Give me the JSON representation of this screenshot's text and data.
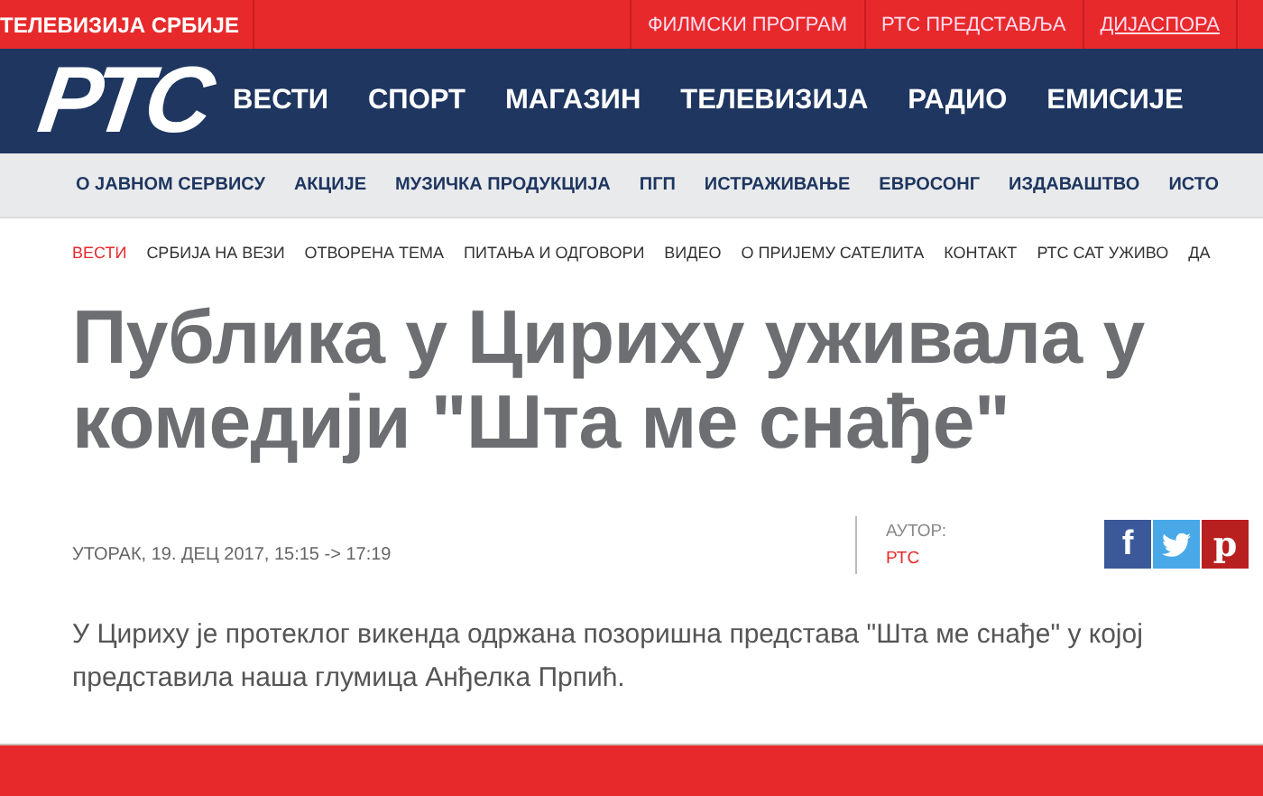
{
  "top_bar": {
    "site_name": "ТЕЛЕВИЗИЈА СРБИЈЕ",
    "links": [
      {
        "label": "ФИЛМСКИ ПРОГРАМ",
        "selected": false
      },
      {
        "label": "РТС ПРЕДСТАВЉА",
        "selected": false
      },
      {
        "label": "ДИЈАСПОРА",
        "selected": true
      }
    ]
  },
  "header": {
    "logo": "РТС",
    "nav": [
      "ВЕСТИ",
      "СПОРТ",
      "МАГАЗИН",
      "ТЕЛЕВИЗИЈА",
      "РАДИО",
      "ЕМИСИЈЕ"
    ]
  },
  "secondary_nav": [
    "О ЈАВНОМ СЕРВИСУ",
    "АКЦИЈЕ",
    "МУЗИЧКА ПРОДУКЦИЈА",
    "ПГП",
    "ИСТРАЖИВАЊЕ",
    "ЕВРОСОНГ",
    "ИЗДАВАШТВО",
    "ИСТО"
  ],
  "section_nav": [
    {
      "label": "ВЕСТИ",
      "selected": true
    },
    {
      "label": "СРБИЈА НА ВЕЗИ",
      "selected": false
    },
    {
      "label": "ОТВОРЕНА ТЕМА",
      "selected": false
    },
    {
      "label": "ПИТАЊА И ОДГОВОРИ",
      "selected": false
    },
    {
      "label": "ВИДЕО",
      "selected": false
    },
    {
      "label": "О ПРИЈЕМУ САТЕЛИТА",
      "selected": false
    },
    {
      "label": "КОНТАКТ",
      "selected": false
    },
    {
      "label": "РТС САТ УЖИВО",
      "selected": false
    },
    {
      "label": "ДА",
      "selected": false
    }
  ],
  "article": {
    "title": "Публика у Цириху уживала у комедији \"Шта ме снађе\"",
    "date": "УТОРАК, 19. ДЕЦ 2017, 15:15 -> 17:19",
    "author_label": "АУТОР:",
    "author": "РТС",
    "share": [
      {
        "kind": "facebook",
        "glyph": "f"
      },
      {
        "kind": "twitter"
      },
      {
        "kind": "pinterest",
        "glyph": "p"
      }
    ],
    "lead": "У Цириху је протеклог викенда одржана позоришна представа \"Шта ме снађе\" у којој представила наша глумица Анђелка Прпић."
  }
}
